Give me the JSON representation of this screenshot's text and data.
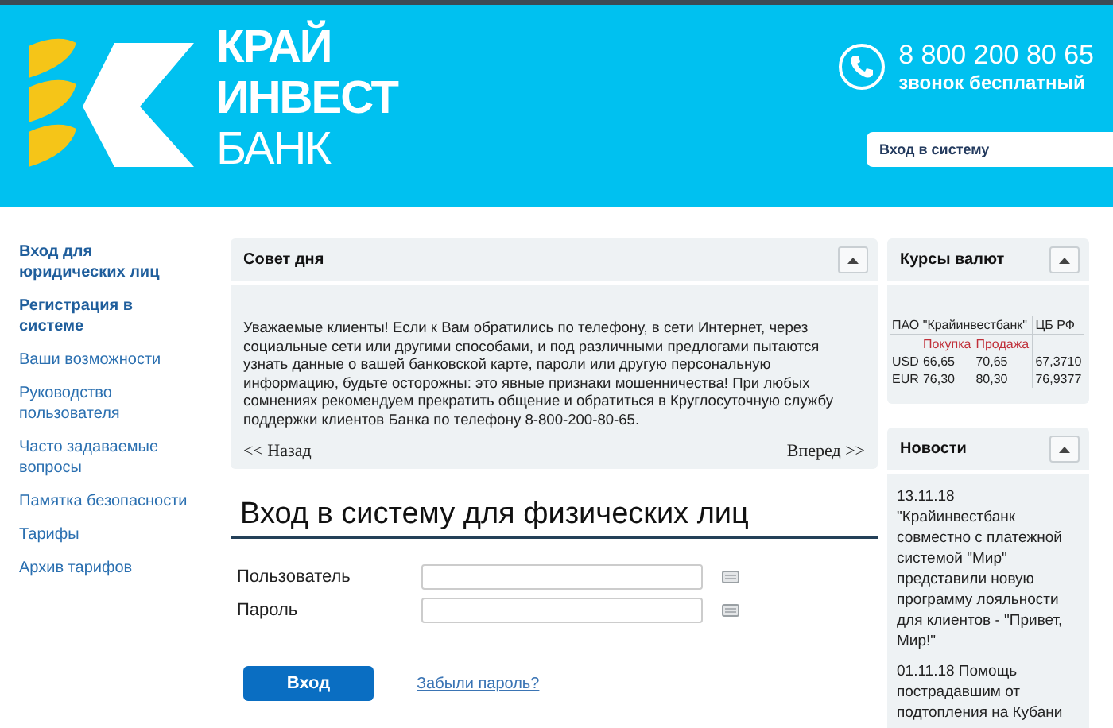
{
  "header": {
    "logo_lines": [
      "КРАЙ",
      "ИНВЕСТ",
      "БАНК"
    ],
    "phone": "8 800 200 80 65",
    "phone_note": "звонок бесплатный",
    "login_link": "Вход в систему"
  },
  "sidebar": {
    "items": [
      {
        "label": "Вход для юридических лиц",
        "emphasized": true
      },
      {
        "label": "Регистрация в системе",
        "emphasized": true
      },
      {
        "label": "Ваши возможности",
        "emphasized": false
      },
      {
        "label": "Руководство пользователя",
        "emphasized": false
      },
      {
        "label": "Часто задаваемые вопросы",
        "emphasized": false
      },
      {
        "label": "Памятка безопасности",
        "emphasized": false
      },
      {
        "label": "Тарифы",
        "emphasized": false
      },
      {
        "label": "Архив тарифов",
        "emphasized": false
      }
    ]
  },
  "tip": {
    "title": "Совет дня",
    "expanded": true,
    "text": "Уважаемые клиенты! Если к Вам обратились по телефону, в сети Интернет, через социальные сети или другими способами, и под различными предлогами пытаются узнать данные о вашей банковской карте, пароли или другую персональную информацию, будьте осторожны: это явные признаки мошенничества! При любых сомнениях рекомендуем прекратить общение и обратиться в Круглосуточную службу поддержки клиентов Банка по телефону 8-800-200-80-65.",
    "prev": "<< Назад",
    "next": "Вперед >>"
  },
  "login": {
    "title": "Вход в систему для физических лиц",
    "fields": [
      {
        "label": "Пользователь"
      },
      {
        "label": "Пароль"
      }
    ],
    "submit": "Вход",
    "forgot": "Забыли пароль?"
  },
  "rates": {
    "title": "Курсы валют",
    "expanded": true,
    "bank_header": "ПАО \"Крайинвестбанк\"",
    "cb_header": "ЦБ РФ",
    "buy_header": "Покупка",
    "sell_header": "Продажа",
    "rows": [
      {
        "currency": "USD",
        "buy": "66,65",
        "sell": "70,65",
        "cb": "67,3710"
      },
      {
        "currency": "EUR",
        "buy": "76,30",
        "sell": "80,30",
        "cb": "76,9377"
      }
    ]
  },
  "news": {
    "title": "Новости",
    "expanded": true,
    "items": [
      {
        "date": "13.11.18",
        "text": "\"Крайинвестбанк совместно с платежной системой \"Мир\" представили новую программу лояльности для клиентов - \"Привет, Мир!\""
      },
      {
        "date": "01.11.18",
        "text": "Помощь пострадавшим от подтопления на Кубани"
      }
    ]
  }
}
